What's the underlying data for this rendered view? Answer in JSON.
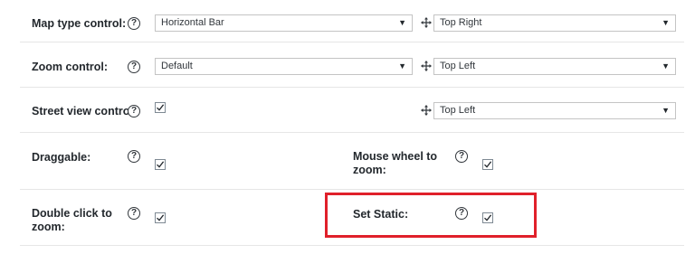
{
  "rows": {
    "map_type": {
      "label": "Map type control:",
      "select_value": "Horizontal Bar",
      "position_value": "Top Right"
    },
    "zoom": {
      "label": "Zoom control:",
      "select_value": "Default",
      "position_value": "Top Left"
    },
    "street_view": {
      "label": "Street view control:",
      "checked": true,
      "position_value": "Top Left"
    },
    "draggable": {
      "label": "Draggable:",
      "checked": true
    },
    "mouse_wheel": {
      "label_line1": "Mouse wheel to",
      "label_line2": "zoom:",
      "checked": true
    },
    "double_click": {
      "label_line1": "Double click to",
      "label_line2": "zoom:",
      "checked": true
    },
    "set_static": {
      "label": "Set Static:",
      "checked": true
    }
  },
  "icons": {
    "help": "help-icon",
    "checkbox": "checkmark-icon",
    "move": "move-arrows-icon",
    "dropdown": "chevron-down-icon"
  },
  "colors": {
    "highlight": "#e0202a",
    "text": "#23282d",
    "border": "#c4c4c4"
  }
}
